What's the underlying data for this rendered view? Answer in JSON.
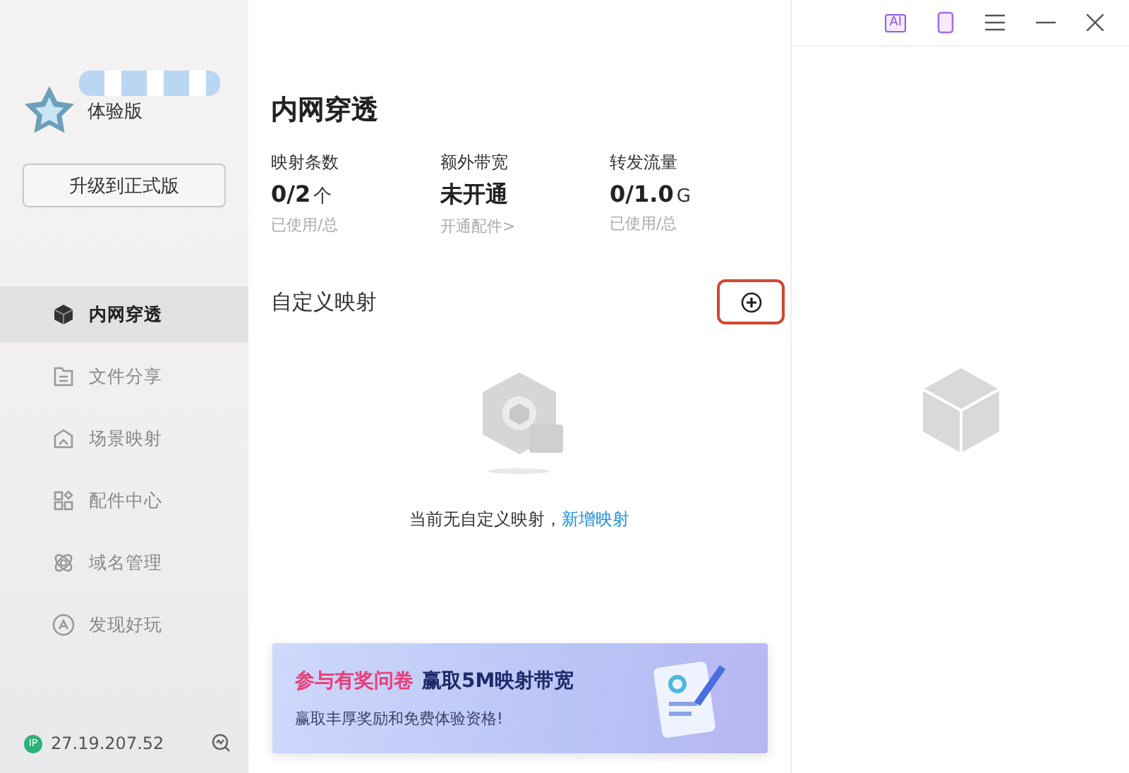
{
  "title_bar": {
    "ai_label": "AI"
  },
  "sidebar": {
    "edition": "体验版",
    "upgrade_button": "升级到正式版",
    "items": [
      {
        "label": "内网穿透",
        "selected": true
      },
      {
        "label": "文件分享",
        "selected": false
      },
      {
        "label": "场景映射",
        "selected": false
      },
      {
        "label": "配件中心",
        "selected": false
      },
      {
        "label": "域名管理",
        "selected": false
      },
      {
        "label": "发现好玩",
        "selected": false
      }
    ],
    "ip_badge": "IP",
    "ip": "27.19.207.52"
  },
  "main": {
    "title": "内网穿透",
    "stats": [
      {
        "label": "映射条数",
        "value": "0/2",
        "unit": "个",
        "note": "已使用/总"
      },
      {
        "label": "额外带宽",
        "value": "未开通",
        "note": "开通配件>"
      },
      {
        "label": "转发流量",
        "value": "0/1.0",
        "unit": "G",
        "note": "已使用/总"
      }
    ],
    "section_title": "自定义映射",
    "empty_text": "当前无自定义映射，",
    "empty_link": "新增映射",
    "banner": {
      "highlight": "参与有奖问卷",
      "title": "赢取5M映射带宽",
      "subtitle": "赢取丰厚奖励和免费体验资格!"
    }
  }
}
